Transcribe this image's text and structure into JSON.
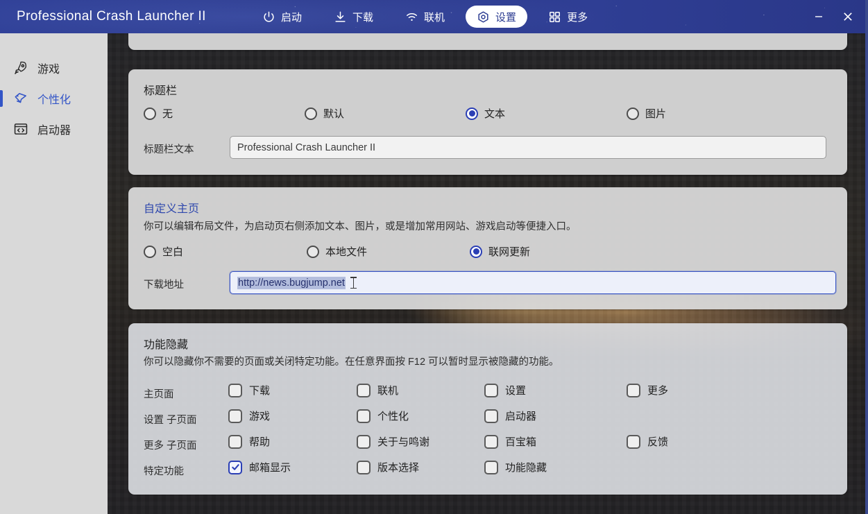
{
  "window": {
    "title": "Professional Crash Launcher II",
    "minimize_label": "—",
    "close_label": "✕"
  },
  "nav": {
    "items": [
      {
        "label": "启动",
        "icon": "power-icon",
        "active": false
      },
      {
        "label": "下载",
        "icon": "download-icon",
        "active": false
      },
      {
        "label": "联机",
        "icon": "wifi-icon",
        "active": false
      },
      {
        "label": "设置",
        "icon": "gear-icon",
        "active": true
      },
      {
        "label": "更多",
        "icon": "grid-icon",
        "active": false
      }
    ]
  },
  "sidebar": {
    "items": [
      {
        "label": "游戏",
        "icon": "rocket-icon",
        "active": false
      },
      {
        "label": "个性化",
        "icon": "tag-icon",
        "active": true
      },
      {
        "label": "启动器",
        "icon": "code-window-icon",
        "active": false
      }
    ]
  },
  "titlebar_section": {
    "title": "标题栏",
    "options": [
      {
        "label": "无",
        "selected": false
      },
      {
        "label": "默认",
        "selected": false
      },
      {
        "label": "文本",
        "selected": true
      },
      {
        "label": "图片",
        "selected": false
      }
    ],
    "field_label": "标题栏文本",
    "field_value": "Professional Crash Launcher II"
  },
  "homepage_section": {
    "title": "自定义主页",
    "description": "你可以编辑布局文件，为启动页右侧添加文本、图片，或是增加常用网站、游戏启动等便捷入口。",
    "options": [
      {
        "label": "空白",
        "selected": false
      },
      {
        "label": "本地文件",
        "selected": false
      },
      {
        "label": "联网更新",
        "selected": true
      }
    ],
    "field_label": "下载地址",
    "field_value": "http://news.bugjump.net",
    "field_focused": true,
    "field_text_selected": true
  },
  "hide_section": {
    "title": "功能隐藏",
    "description": "你可以隐藏你不需要的页面或关闭特定功能。在任意界面按 F12 可以暂时显示被隐藏的功能。",
    "rows": [
      {
        "label": "主页面",
        "items": [
          {
            "label": "下载",
            "checked": false
          },
          {
            "label": "联机",
            "checked": false
          },
          {
            "label": "设置",
            "checked": false
          },
          {
            "label": "更多",
            "checked": false
          }
        ]
      },
      {
        "label": "设置 子页面",
        "items": [
          {
            "label": "游戏",
            "checked": false
          },
          {
            "label": "个性化",
            "checked": false
          },
          {
            "label": "启动器",
            "checked": false
          }
        ]
      },
      {
        "label": "更多 子页面",
        "items": [
          {
            "label": "帮助",
            "checked": false
          },
          {
            "label": "关于与鸣谢",
            "checked": false
          },
          {
            "label": "百宝箱",
            "checked": false
          },
          {
            "label": "反馈",
            "checked": false
          }
        ]
      },
      {
        "label": "特定功能",
        "items": [
          {
            "label": "邮箱显示",
            "checked": true
          },
          {
            "label": "版本选择",
            "checked": false
          },
          {
            "label": "功能隐藏",
            "checked": false
          }
        ]
      }
    ]
  },
  "colors": {
    "header_blue": "#2f3f96",
    "accent_blue": "#2b3fb5",
    "sidebar_bg": "#d9d9d9",
    "card_bg": "#dadada",
    "selection_bg": "#b3bddd"
  }
}
